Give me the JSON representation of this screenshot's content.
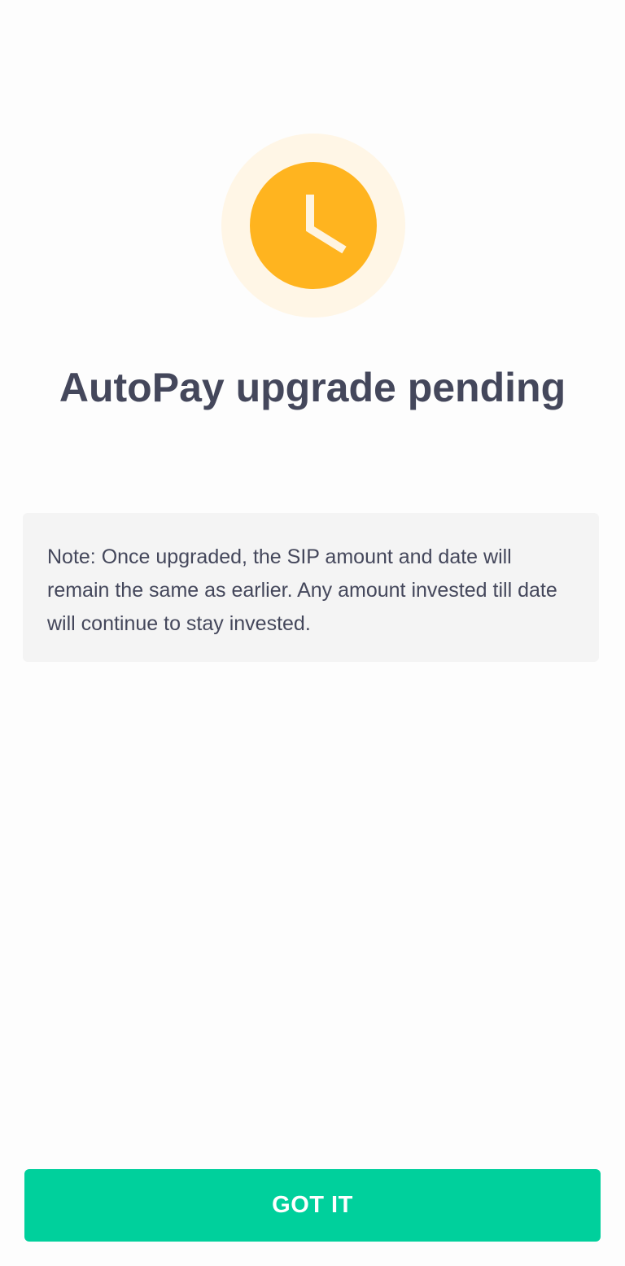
{
  "status": {
    "icon": "clock-icon",
    "outer_color": "#fff6e6",
    "circle_color": "#ffb41f",
    "hands_color": "#fff4e0"
  },
  "title": "AutoPay upgrade pending",
  "note": {
    "text": "Note: Once upgraded, the SIP amount and date will remain the same as earlier. Any amount invested till date will continue to stay invested."
  },
  "primary_button": {
    "label": "GOT IT",
    "color": "#00d09c"
  }
}
